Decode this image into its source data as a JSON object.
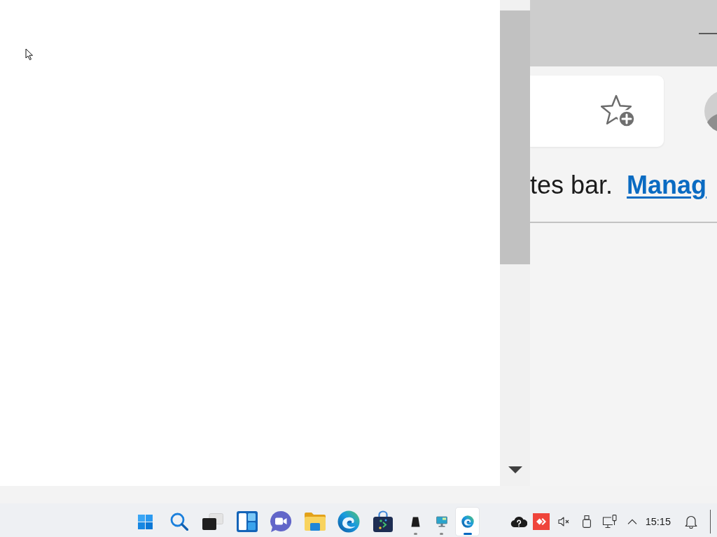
{
  "browser": {
    "favorites_text": "tes bar.",
    "manage_link": "Manag"
  },
  "taskbar": {
    "apps": [
      {
        "kind": "start",
        "compact": false,
        "running": false,
        "selected": false
      },
      {
        "kind": "search",
        "compact": false,
        "running": false,
        "selected": false
      },
      {
        "kind": "task-view",
        "compact": false,
        "running": false,
        "selected": false
      },
      {
        "kind": "widgets",
        "compact": false,
        "running": false,
        "selected": false
      },
      {
        "kind": "chat",
        "compact": false,
        "running": false,
        "selected": false
      },
      {
        "kind": "files",
        "compact": false,
        "running": false,
        "selected": false
      },
      {
        "kind": "edge",
        "compact": false,
        "running": false,
        "selected": false
      },
      {
        "kind": "store",
        "compact": false,
        "running": false,
        "selected": false
      },
      {
        "kind": "dark-app",
        "compact": true,
        "running": true,
        "selected": false
      },
      {
        "kind": "monitor-app",
        "compact": true,
        "running": true,
        "selected": false
      },
      {
        "kind": "edge",
        "compact": true,
        "running": true,
        "selected": true
      }
    ],
    "tray": {
      "volume_muted": true,
      "clock": "15:15"
    }
  }
}
